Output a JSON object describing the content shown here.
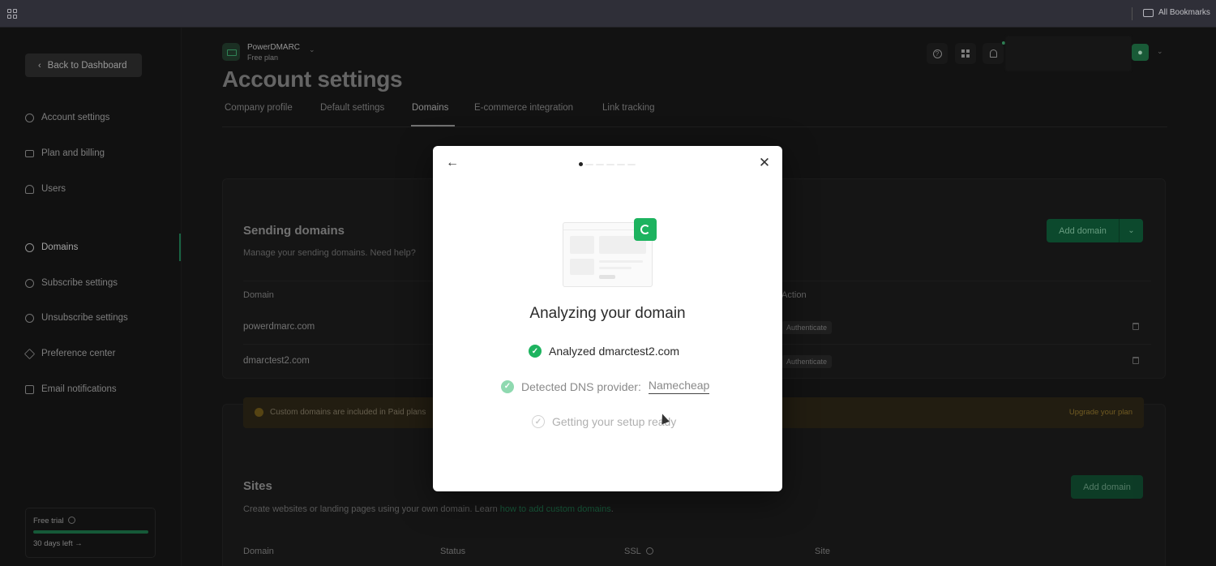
{
  "browser": {
    "bookmarks_label": "All Bookmarks"
  },
  "sidebar": {
    "back_label": "Back to Dashboard",
    "items": [
      {
        "label": "Account settings",
        "icon": "gear-icon"
      },
      {
        "label": "Plan and billing",
        "icon": "card-icon"
      },
      {
        "label": "Users",
        "icon": "user-icon"
      },
      {
        "label": "Domains",
        "icon": "globe-icon"
      },
      {
        "label": "Subscribe settings",
        "icon": "gear-icon"
      },
      {
        "label": "Unsubscribe settings",
        "icon": "gear-icon"
      },
      {
        "label": "Preference center",
        "icon": "layers-icon"
      },
      {
        "label": "Email notifications",
        "icon": "inbox-icon"
      }
    ],
    "trial": {
      "title": "Free trial",
      "days_left": "30 days left →",
      "progress": 1.0
    }
  },
  "header": {
    "org_name": "PowerDMARC",
    "org_plan": "Free plan"
  },
  "page": {
    "title": "Account settings",
    "tabs": [
      "Company profile",
      "Default settings",
      "Domains",
      "E-commerce integration",
      "Link tracking"
    ],
    "active_tab": "Domains"
  },
  "sending_domains": {
    "title": "Sending domains",
    "subtitle": "Manage your sending domains. Need help?",
    "add_label": "Add domain",
    "columns": {
      "domain": "Domain",
      "action": "Action"
    },
    "rows": [
      {
        "domain": "powerdmarc.com",
        "action": "Authenticate"
      },
      {
        "domain": "dmarctest2.com",
        "action": "Authenticate"
      }
    ]
  },
  "banner": {
    "text": "Custom domains are included in Paid plans",
    "link": "Upgrade your plan"
  },
  "sites": {
    "title": "Sites",
    "subtitle_prefix": "Create websites or landing pages using your own domain. Learn",
    "subtitle_link": "how to add custom domains",
    "subtitle_suffix": ".",
    "add_label": "Add domain",
    "columns": [
      "Domain",
      "Status",
      "SSL",
      "Site"
    ]
  },
  "modal": {
    "title": "Analyzing your domain",
    "step1": "Analyzed dmarctest2.com",
    "step2_label": "Detected DNS provider:",
    "step2_value": "Namecheap",
    "step3": "Getting your setup ready",
    "accent_color": "#1db35f"
  }
}
